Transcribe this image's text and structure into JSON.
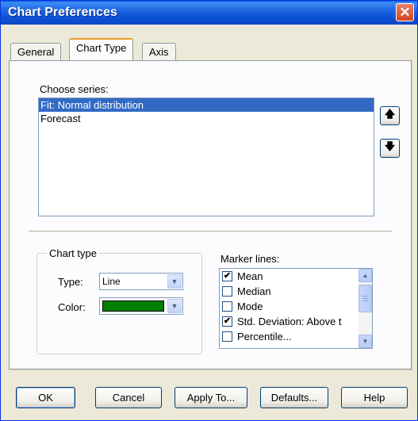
{
  "window": {
    "title": "Chart Preferences",
    "close_icon": "close-icon"
  },
  "tabs": [
    {
      "label": "General",
      "active": false
    },
    {
      "label": "Chart Type",
      "active": true
    },
    {
      "label": "Axis",
      "active": false
    }
  ],
  "series": {
    "label": "Choose series:",
    "items": [
      "Fit: Normal distribution",
      "Forecast"
    ],
    "selected_index": 0,
    "up_icon": "arrow-up-icon",
    "down_icon": "arrow-down-icon"
  },
  "chart_type": {
    "group_label": "Chart type",
    "type_label": "Type:",
    "type_value": "Line",
    "color_label": "Color:",
    "color_value": "#008000"
  },
  "marker_lines": {
    "label": "Marker lines:",
    "items": [
      {
        "label": "Mean",
        "checked": true
      },
      {
        "label": "Median",
        "checked": false
      },
      {
        "label": "Mode",
        "checked": false
      },
      {
        "label": "Std. Deviation: Above t",
        "checked": true
      },
      {
        "label": "Percentile...",
        "checked": false
      }
    ]
  },
  "buttons": {
    "ok": "OK",
    "cancel": "Cancel",
    "apply_to": "Apply To...",
    "defaults": "Defaults...",
    "help": "Help"
  },
  "colors": {
    "titlebar": "#0c52d6",
    "selection": "#316ac5",
    "dialog_bg": "#ece9d8"
  }
}
